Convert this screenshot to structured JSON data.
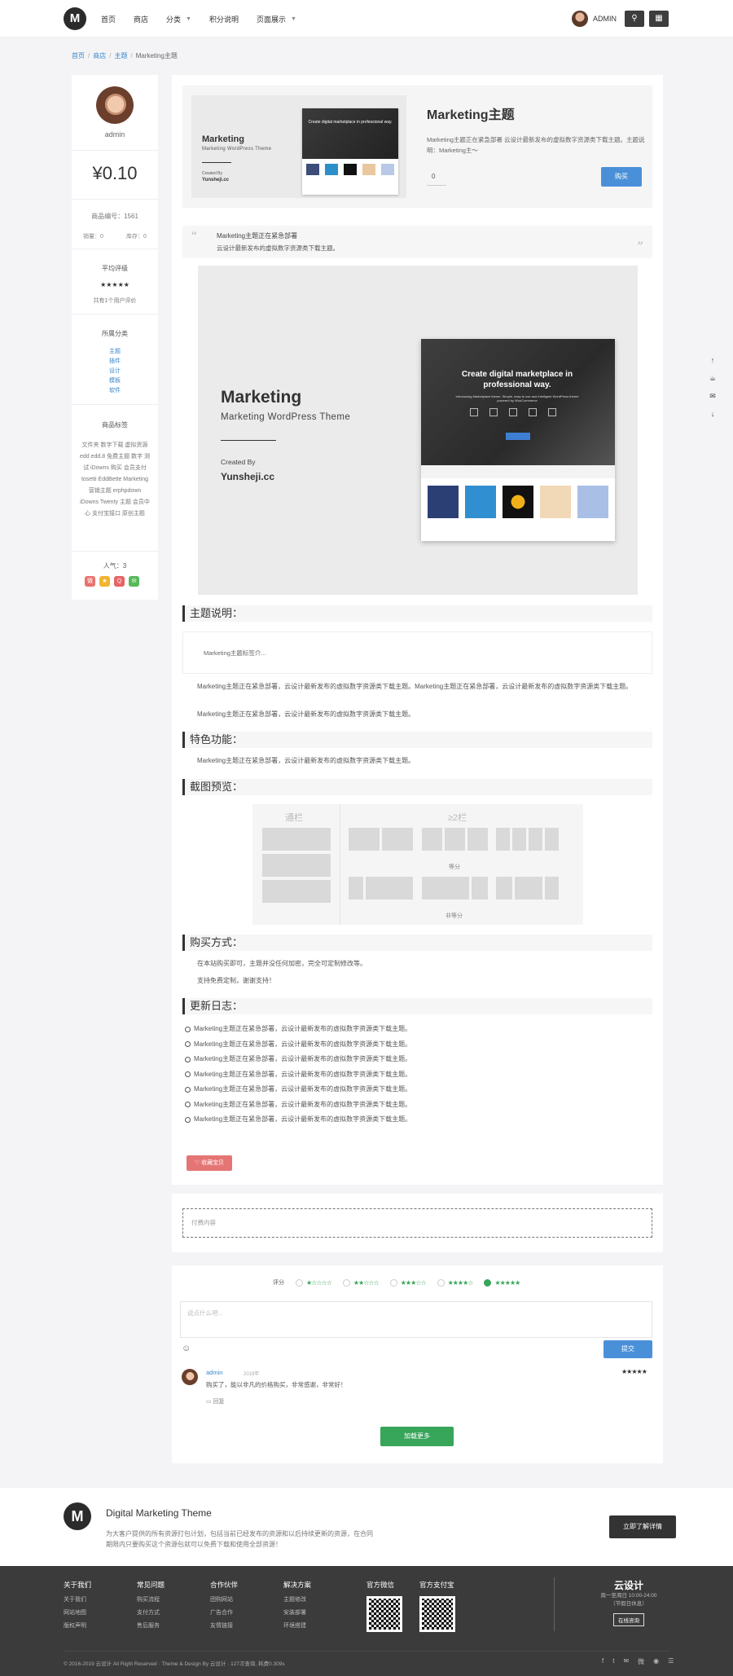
{
  "header": {
    "logo": "M",
    "nav": [
      {
        "label": "首页",
        "caret": false
      },
      {
        "label": "商店",
        "caret": false
      },
      {
        "label": "分类",
        "caret": true
      },
      {
        "label": "积分说明",
        "caret": false
      },
      {
        "label": "页面展示",
        "caret": true
      }
    ],
    "user_name": "ADMIN",
    "search_icon": "⚲",
    "grid_icon": "▦"
  },
  "breadcrumb": {
    "items": [
      "首页",
      "商店",
      "主题"
    ],
    "current": "Marketing主题"
  },
  "sidebar": {
    "author": "admin",
    "price": "¥0.10",
    "product_id": "商品编号：1561",
    "sales": "销量：0",
    "stock": "库存：0",
    "rating_title": "平均评级",
    "rating_stars": "★★★★★",
    "rating_count": "共有1个用户评价",
    "category_title": "所属分类",
    "categories": [
      "主题",
      "插件",
      "设计",
      "模板",
      "软件"
    ],
    "tags_title": "商品标签",
    "tags": "文件夹 数字下载 虚拟资源 edd edd.8 免费主题 数字 测试 iDowns 购买 会员支付 tosetti EddBette Marketing 营销主题 erphpdown iDowns Twenty 主题 会员中心 支付宝接口 原创主题",
    "popularity": "人气：3",
    "share": [
      {
        "icon": "weibo-icon",
        "glyph": "微",
        "color": "#e8726d"
      },
      {
        "icon": "qzone-icon",
        "glyph": "★",
        "color": "#f2b431"
      },
      {
        "icon": "qq-icon",
        "glyph": "Q",
        "color": "#e56565"
      },
      {
        "icon": "wechat-icon",
        "glyph": "✉",
        "color": "#57b95a"
      }
    ]
  },
  "product": {
    "thumb_title": "Marketing",
    "thumb_sub": "Marketing WordPress Theme",
    "thumb_by": "Created By",
    "thumb_author": "Yunsheji.cc",
    "screenshot_headline": "Create digital marketplace in professional way.",
    "title": "Marketing主题",
    "desc": "Marketing主题正在紧急部署 云设计最新发布的虚拟数字资源类下载主题。主题说明：Marketing主～",
    "qty": "0",
    "buy_label": "购买"
  },
  "quote": {
    "line1": "Marketing主题正在紧急部署",
    "line2": "云设计最新发布的虚拟数字资源类下载主题。"
  },
  "big_image": {
    "title": "Marketing",
    "subtitle": "Marketing WordPress Theme",
    "by": "Created By",
    "author": "Yunsheji.cc",
    "headline": "Create digital marketplace in professional way.",
    "sub": "Introducing Marketplace theme. Simple, easy to use and intelligent WordPress theme powered by WooCommerce"
  },
  "sections": {
    "intro_title": "主题说明：",
    "intro_excerpt": "Marketing主题标签介...",
    "intro_p1": "Marketing主题正在紧急部署，云设计最新发布的虚拟数字资源类下载主题。Marketing主题正在紧急部署，云设计最新发布的虚拟数字资源类下载主题。",
    "intro_p2": "Marketing主题正在紧急部署，云设计最新发布的虚拟数字资源类下载主题。",
    "features_title": "特色功能：",
    "features_p": "Marketing主题正在紧急部署，云设计最新发布的虚拟数字资源类下载主题。",
    "preview_title": "截图预览：",
    "layout_one": "通栏",
    "layout_two": "≥2栏",
    "cap_equal": "等分",
    "cap_unequal": "非等分",
    "buy_title": "购买方式：",
    "buy_p1": "在本站购买即可，主题并没任何加密，完全可定制修改等。",
    "buy_p2": "支持免费定制，谢谢支持！",
    "log_title": "更新日志：",
    "log_items": [
      "Marketing主题正在紧急部署，云设计最新发布的虚拟数字资源类下载主题。",
      "Marketing主题正在紧急部署，云设计最新发布的虚拟数字资源类下载主题。",
      "Marketing主题正在紧急部署，云设计最新发布的虚拟数字资源类下载主题。",
      "Marketing主题正在紧急部署，云设计最新发布的虚拟数字资源类下载主题。",
      "Marketing主题正在紧急部署，云设计最新发布的虚拟数字资源类下载主题。",
      "Marketing主题正在紧急部署，云设计最新发布的虚拟数字资源类下载主题。",
      "Marketing主题正在紧急部署，云设计最新发布的虚拟数字资源类下载主题。"
    ],
    "fav_label": "♡ 收藏宝贝"
  },
  "hidden": {
    "placeholder": "付费内容"
  },
  "comments": {
    "rating_label": "评分",
    "options": [
      "★☆☆☆☆",
      "★★☆☆☆",
      "★★★☆☆",
      "★★★★☆",
      "★★★★★"
    ],
    "selected": 4,
    "placeholder": "说点什么吧...",
    "submit": "提交",
    "item": {
      "name": "admin",
      "date": "2019年",
      "text": "购买了，能以非凡的价格购买，非常感谢，非常好！",
      "reply": "回复",
      "stars": "★★★★★"
    },
    "load_more": "加载更多"
  },
  "float_tools": [
    "↑",
    "☕",
    "✉",
    "↓"
  ],
  "cta": {
    "logo": "M",
    "title": "Digital Marketing Theme",
    "desc": "为大客户提供的所有资源打包计划，包括当前已经发布的资源和以后持续更新的资源，在合同期限内只要购买这个资源包就可以免费下载和使用全部资源！",
    "button": "立即了解详情"
  },
  "footer": {
    "cols": [
      {
        "title": "关于我们",
        "links": [
          "关于我们",
          "网站地图",
          "版权声明"
        ]
      },
      {
        "title": "常见问题",
        "links": [
          "购买流程",
          "支付方式",
          "售后服务"
        ]
      },
      {
        "title": "合作伙伴",
        "links": [
          "团购网站",
          "广告合作",
          "友情链接"
        ]
      },
      {
        "title": "解决方案",
        "links": [
          "主题修改",
          "安装部署",
          "环境搭建"
        ]
      }
    ],
    "qr_wechat": "官方微信",
    "qr_alipay": "官方支付宝",
    "brand": "云设计",
    "hours": "周一至周日 10:00-24:00",
    "hours_note": "（节假日休息）",
    "consult": "在线咨询",
    "copyright": "© 2016-2019  云设计 All Right Reserved · Theme & Design By 云设计 · 127次查询, 耗费0.309s",
    "socials": [
      "f",
      "t",
      "✉",
      "微",
      "◉",
      "☰"
    ]
  }
}
